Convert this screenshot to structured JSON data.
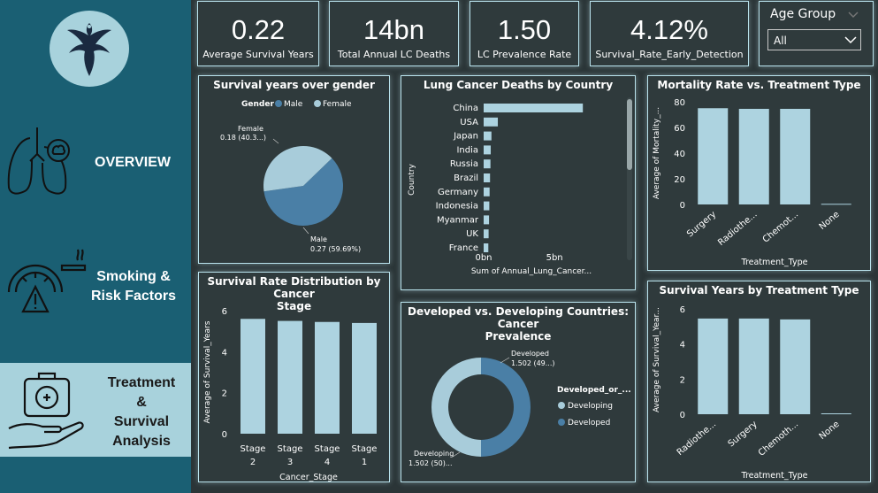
{
  "sidebar": {
    "nav": [
      {
        "label": "OVERVIEW",
        "active": false
      },
      {
        "label": "Smoking &\nRisk Factors",
        "active": false
      },
      {
        "label": "Treatment\n&\nSurvival\nAnalysis",
        "active": true
      }
    ]
  },
  "kpis": [
    {
      "value": "0.22",
      "label": "Average Survival Years"
    },
    {
      "value": "14bn",
      "label": "Total Annual LC Deaths"
    },
    {
      "value": "1.50",
      "label": "LC Prevalence Rate"
    },
    {
      "value": "4.12%",
      "label": "Survival_Rate_Early_Detection"
    }
  ],
  "slicer": {
    "title": "Age Group",
    "value": "All"
  },
  "colors": {
    "male": "#4a7fa6",
    "female": "#a8ccda",
    "bar": "#add3e0"
  },
  "chart_data": [
    {
      "id": "gender_pie",
      "type": "pie",
      "title": "Survival years over gender",
      "legend_title": "Gender",
      "legend": [
        "Male",
        "Female"
      ],
      "slices": [
        {
          "name": "Male",
          "value": 0.27,
          "pct": "59.69%",
          "label_line1": "Male",
          "label_line2": "0.27 (59.69%)"
        },
        {
          "name": "Female",
          "value": 0.18,
          "pct": "40.3…",
          "label_line1": "Female",
          "label_line2": "0.18 (40.3...)"
        }
      ]
    },
    {
      "id": "deaths_by_country",
      "type": "bar",
      "orientation": "horizontal",
      "title": "Lung Cancer Deaths by Country",
      "categories": [
        "China",
        "USA",
        "Japan",
        "India",
        "Russia",
        "Brazil",
        "Germany",
        "Indonesia",
        "Myanmar",
        "UK",
        "France"
      ],
      "values": [
        7.0,
        1.0,
        0.55,
        0.5,
        0.48,
        0.45,
        0.42,
        0.4,
        0.38,
        0.35,
        0.33
      ],
      "xlabel": "Sum of Annual_Lung_Cancer...",
      "ylabel": "Country",
      "xticks": [
        "0bn",
        "5bn"
      ],
      "xtick_values": [
        0,
        5
      ],
      "xlim": [
        0,
        7.3
      ]
    },
    {
      "id": "mortality_vs_treatment",
      "type": "bar",
      "title": "Mortality Rate vs. Treatment Type",
      "categories": [
        "Surgery",
        "Radiothe...",
        "Chemot...",
        "None"
      ],
      "values": [
        75,
        74.5,
        74.5,
        0.5
      ],
      "ylabel": "Average of Mortality_...",
      "xlabel": "Treatment_Type",
      "yticks": [
        0,
        20,
        40,
        60,
        80
      ],
      "ylim": [
        0,
        80
      ]
    },
    {
      "id": "survival_by_stage",
      "type": "bar",
      "title": "Survival Rate Distribution by Cancer Stage",
      "title_lines": [
        "Survival Rate Distribution by Cancer",
        "Stage"
      ],
      "categories": [
        "Stage 2",
        "Stage 3",
        "Stage 4",
        "Stage 1"
      ],
      "cat_lines": [
        [
          "Stage",
          "2"
        ],
        [
          "Stage",
          "3"
        ],
        [
          "Stage",
          "4"
        ],
        [
          "Stage",
          "1"
        ]
      ],
      "values": [
        5.6,
        5.5,
        5.45,
        5.4
      ],
      "ylabel": "Average of Survival_Years",
      "xlabel": "Cancer_Stage",
      "yticks": [
        0,
        2,
        4,
        6
      ],
      "ylim": [
        0,
        6
      ]
    },
    {
      "id": "developed_donut",
      "type": "pie",
      "title": "Developed vs. Developing Countries: Cancer Prevalence",
      "title_lines": [
        "Developed vs. Developing Countries: Cancer",
        "Prevalence"
      ],
      "legend_title": "Developed_or_...",
      "legend": [
        "Developing",
        "Developed"
      ],
      "slices": [
        {
          "name": "Developing",
          "value": 1.502,
          "label_line1": "Developing",
          "label_line2": "1.502 (50)..."
        },
        {
          "name": "Developed",
          "value": 1.502,
          "label_line1": "Developed",
          "label_line2": "1.502 (49...)"
        }
      ]
    },
    {
      "id": "survival_by_treatment",
      "type": "bar",
      "title": "Survival Years by Treatment Type",
      "categories": [
        "Radiothe...",
        "Surgery",
        "Chemoth...",
        "None"
      ],
      "values": [
        5.45,
        5.45,
        5.4,
        0.05
      ],
      "ylabel": "Average of Survival_Year...",
      "xlabel": "Treatment_Type",
      "yticks": [
        0,
        2,
        4,
        6
      ],
      "ylim": [
        0,
        6.2
      ]
    }
  ]
}
